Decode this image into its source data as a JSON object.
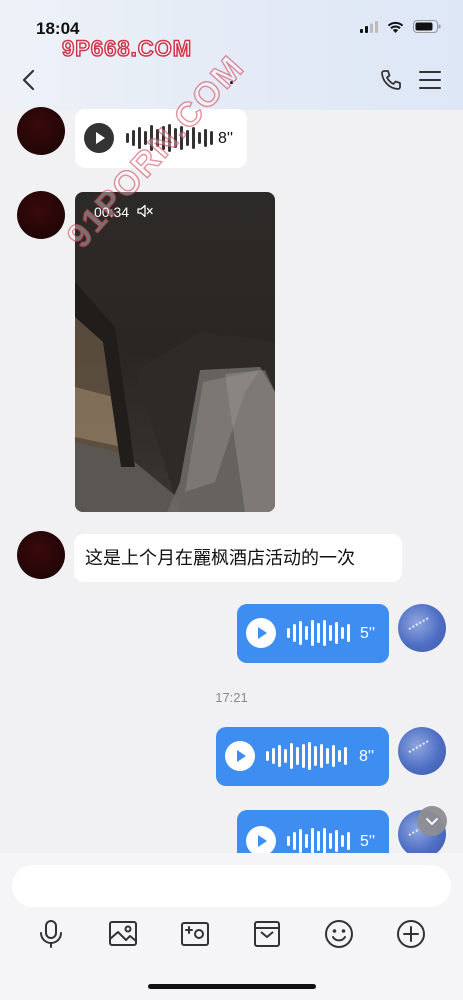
{
  "status": {
    "time": "18:04"
  },
  "watermarks": {
    "top": "9P668.COM",
    "diagonal": "91PORN.COM"
  },
  "header": {
    "title": "."
  },
  "messages": {
    "voice1_duration": "8''",
    "video_duration": "00:34",
    "text1": "这是上个月在麗枫酒店活动的一次",
    "voice2_duration": "5''",
    "timestamp": "17:21",
    "voice3_duration": "8''",
    "voice4_duration": "5''"
  },
  "input": {
    "placeholder": ""
  },
  "colors": {
    "accent": "#3d8ef0",
    "bubble_white": "#ffffff",
    "background": "#f1f1f3"
  },
  "icons": [
    "microphone-icon",
    "image-icon",
    "video-camera-icon",
    "envelope-icon",
    "emoji-icon",
    "plus-icon"
  ]
}
